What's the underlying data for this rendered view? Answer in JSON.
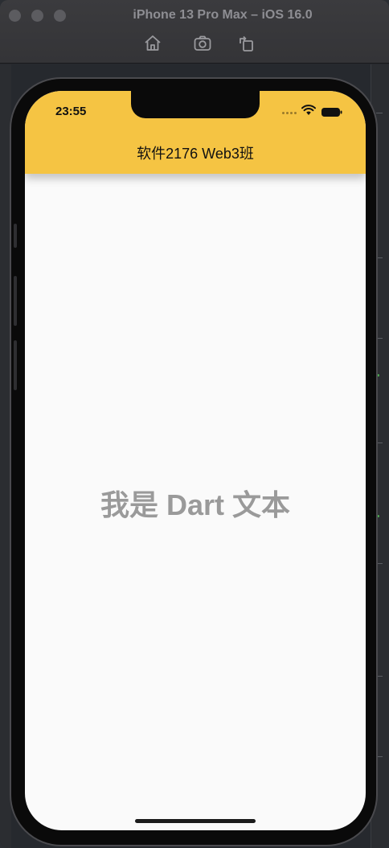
{
  "window": {
    "title": "iPhone 13 Pro Max – iOS 16.0",
    "toolbar": {
      "home_icon": "home-icon",
      "screenshot_icon": "camera-icon",
      "rotate_icon": "rotate-icon"
    }
  },
  "device": {
    "status_bar": {
      "time": "23:55",
      "icons": [
        "signal-dots-icon",
        "wifi-icon",
        "battery-icon"
      ]
    },
    "app": {
      "appbar_title": "软件2176 Web3班",
      "body_text": "我是 Dart 文本",
      "appbar_color": "#f5c443",
      "background_color": "#fafafa",
      "body_text_color": "#9a9a9a"
    }
  }
}
